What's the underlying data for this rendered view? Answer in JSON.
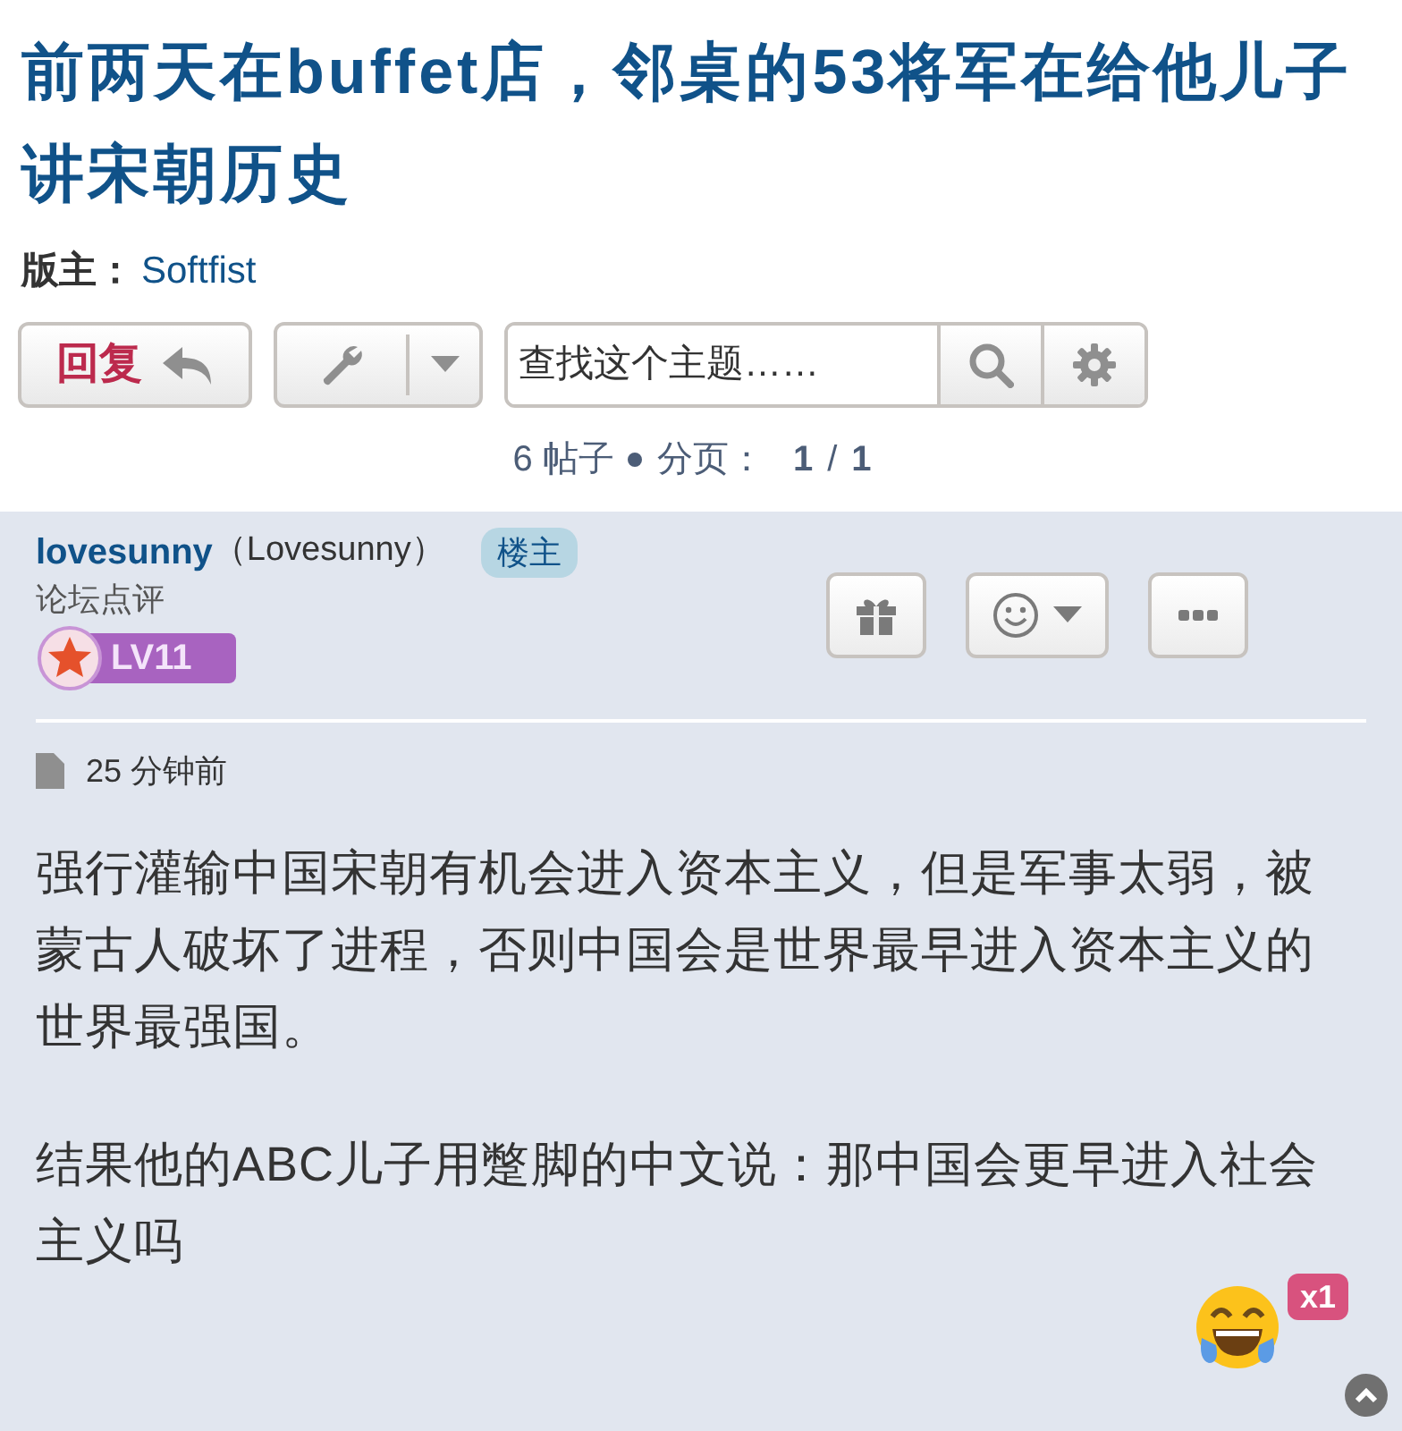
{
  "title": "前两天在buffet店，邻桌的53将军在给他儿子讲宋朝历史",
  "moderator": {
    "label": "版主：",
    "name": "Softfist"
  },
  "toolbar": {
    "reply": "回复",
    "search_placeholder": "查找这个主题……"
  },
  "pagination": {
    "posts": "6 帖子",
    "pages_label": "分页：",
    "current": "1",
    "separator": "/",
    "total": "1"
  },
  "post": {
    "author": "lovesunny",
    "display_name": "（Lovesunny）",
    "badge": "楼主",
    "rank": "论坛点评",
    "level": "LV11",
    "time": "25 分钟前",
    "paragraphs": [
      "强行灌输中国宋朝有机会进入资本主义，但是军事太弱，被蒙古人破坏了进程，否则中国会是世界最早进入资本主义的世界最强国。",
      "结果他的ABC儿子用蹩脚的中文说：那中国会更早进入社会主义吗"
    ],
    "reaction_count": "x1"
  }
}
